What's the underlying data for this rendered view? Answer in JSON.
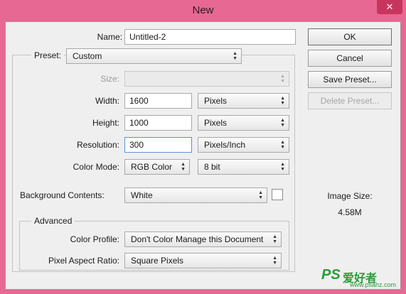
{
  "window": {
    "title": "New",
    "close_glyph": "✕"
  },
  "form": {
    "name_label": "Name:",
    "name_value": "Untitled-2",
    "preset_label": "Preset:",
    "preset_value": "Custom",
    "size_label": "Size:",
    "size_value": "",
    "width_label": "Width:",
    "width_value": "1600",
    "width_unit": "Pixels",
    "height_label": "Height:",
    "height_value": "1000",
    "height_unit": "Pixels",
    "resolution_label": "Resolution:",
    "resolution_value": "300",
    "resolution_unit": "Pixels/Inch",
    "color_mode_label": "Color Mode:",
    "color_mode_value": "RGB Color",
    "bit_depth_value": "8 bit",
    "background_label": "Background Contents:",
    "background_value": "White",
    "background_swatch_color": "#ffffff",
    "advanced_legend": "Advanced",
    "color_profile_label": "Color Profile:",
    "color_profile_value": "Don't Color Manage this Document",
    "pixel_aspect_label": "Pixel Aspect Ratio:",
    "pixel_aspect_value": "Square Pixels"
  },
  "buttons": {
    "ok": "OK",
    "cancel": "Cancel",
    "save_preset": "Save Preset...",
    "delete_preset": "Delete Preset..."
  },
  "image_size": {
    "label": "Image Size:",
    "value": "4.58M"
  },
  "watermark": {
    "logo": "PS",
    "text": "爱好者",
    "url": "www.psahz.com"
  },
  "colors": {
    "titlebar": "#e76893",
    "close_button": "#c7355e",
    "dialog_bg": "#efefef",
    "focus_border": "#5a8fd8"
  }
}
